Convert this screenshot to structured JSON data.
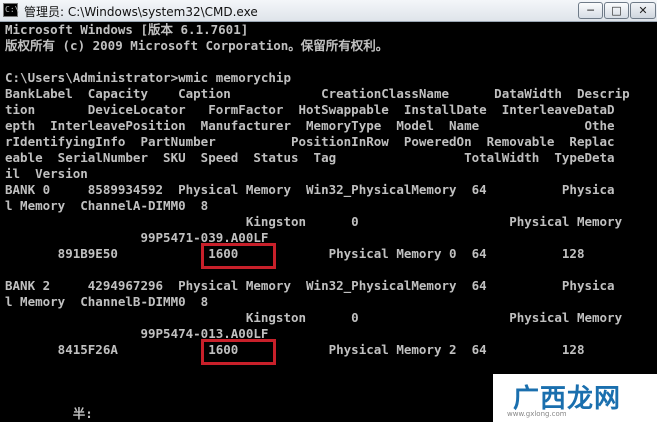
{
  "window": {
    "title": "管理员: C:\\Windows\\system32\\CMD.exe",
    "icon_text": "C:\\",
    "minimize_icon": "minimize-icon",
    "maximize_icon": "maximize-icon",
    "close_icon": "close-icon",
    "btn_min": "─",
    "btn_max": "□",
    "btn_close": "✕"
  },
  "console": {
    "text_color": "#c0c0c0",
    "lines": [
      "Microsoft Windows [版本 6.1.7601]",
      "版权所有 (c) 2009 Microsoft Corporation。保留所有权利。",
      "",
      "C:\\Users\\Administrator>wmic memorychip",
      "BankLabel  Capacity    Caption            CreationClassName      DataWidth  Descrip",
      "tion       DeviceLocator   FormFactor  HotSwappable  InstallDate  InterleaveDataD",
      "epth  InterleavePosition  Manufacturer  MemoryType  Model  Name              Othe",
      "rIdentifyingInfo  PartNumber          PositionInRow  PoweredOn  Removable  Replac",
      "eable  SerialNumber  SKU  Speed  Status  Tag                 TotalWidth  TypeDeta",
      "il  Version",
      "BANK 0     8589934592  Physical Memory  Win32_PhysicalMemory  64          Physica",
      "l Memory  ChannelA-DIMM0  8",
      "                                Kingston      0                    Physical Memory",
      "                  99P5471-039.A00LF",
      "       891B9E50            1600            Physical Memory 0  64          128",
      "",
      "BANK 2     4294967296  Physical Memory  Win32_PhysicalMemory  64          Physica",
      "l Memory  ChannelB-DIMM0  8",
      "                                Kingston      0                    Physical Memory",
      "                  99P5474-013.A00LF",
      "       8415F26A            1600            Physical Memory 2  64          128",
      "",
      "",
      "",
      "         半:"
    ]
  },
  "highlights": {
    "color": "#c8202a",
    "labels": [
      "Speed 1600 (BANK 0)",
      "Speed 1600 (BANK 2)"
    ]
  },
  "watermark": {
    "text": "广西龙网",
    "url": "www.gxlong.com"
  }
}
